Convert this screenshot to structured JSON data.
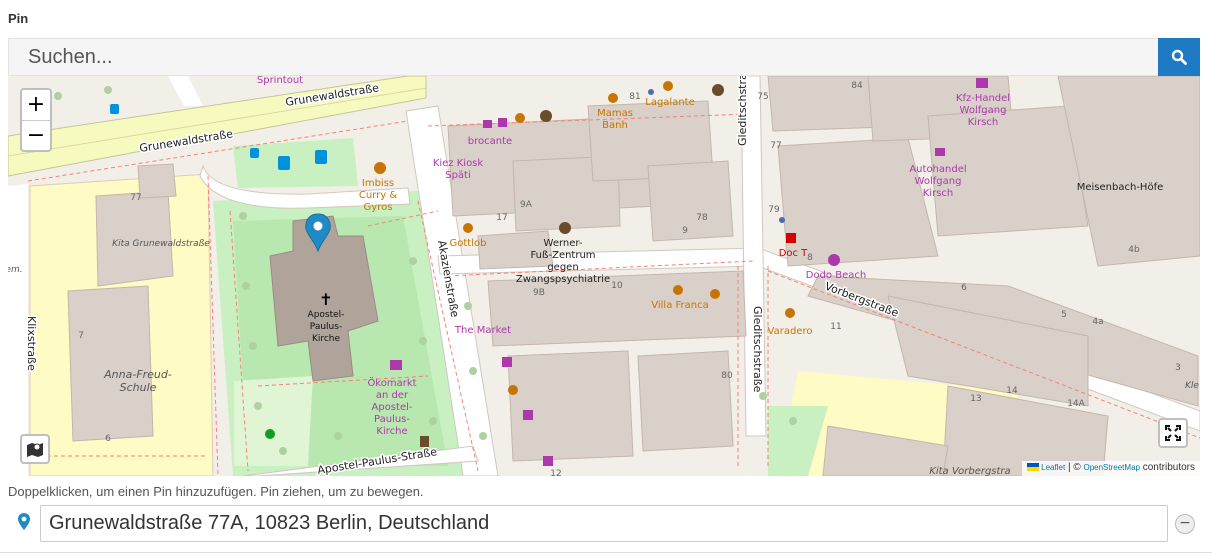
{
  "field": {
    "label": "Pin"
  },
  "search": {
    "placeholder": "Suchen..."
  },
  "map": {
    "zoom_in": "+",
    "zoom_out": "−",
    "attribution": {
      "leaflet": "Leaflet",
      "sep": "| ©",
      "osm": "OpenStreetMap",
      "contributors": "contributors"
    },
    "streets": {
      "grunewald_top": "Grunewaldstraße",
      "grunewald_left": "Grunewaldstraße",
      "akazien": "Akazienstraße",
      "vorberg": "Vorbergstraße",
      "gleditsch_top": "Gleditschstraße",
      "gleditsch_bottom": "Gleditschstraße",
      "klixstrasse": "Klixstraße",
      "apostel_paulus": "Apostel-Paulus-Straße"
    },
    "places": {
      "sprintout": "Sprintout",
      "imbiss_1": "Imbiss",
      "imbiss_2": "Curry &",
      "imbiss_3": "Gyros",
      "kita_grunewald": "Kita Grunewaldstraße",
      "anna_1": "Anna-Freud-",
      "anna_2": "Schule",
      "church_1": "Apostel-",
      "church_2": "Paulus-",
      "church_3": "Kirche",
      "oeko_1": "Ökomarkt",
      "oeko_2": "an der",
      "oeko_3": "Apostel-",
      "oeko_4": "Paulus-",
      "oeko_5": "Kirche",
      "brocante": "brocante",
      "kiez_1": "Kiez Kiosk",
      "kiez_2": "Späti",
      "mamas_1": "Mamas",
      "mamas_2": "Banh",
      "lagalante": "Lagalante",
      "gottlob": "Gottlob",
      "werner_1": "Werner-",
      "werner_2": "Fuß-Zentrum",
      "werner_3": "gegen",
      "werner_4": "Zwangspsychiatrie",
      "market": "The Market",
      "villa": "Villa Franca",
      "varadero": "Varadero",
      "doc": "Doc T",
      "dodo": "Dodo Beach",
      "kfz_1": "Kfz-Handel",
      "kfz_2": "Wolfgang",
      "kfz_3": "Kirsch",
      "auto_1": "Autohandel",
      "auto_2": "Wolfgang",
      "auto_3": "Kirsch",
      "meisenbach": "Meisenbach-Höfe",
      "kita_vorberg": "Kita Vorbergstra",
      "em": "em.",
      "kle": "Kle"
    },
    "numbers": {
      "n77": "77",
      "n7": "7",
      "n6": "6",
      "n9a": "9A",
      "n17": "17",
      "n9": "9",
      "n78": "78",
      "n81": "81",
      "n75": "75",
      "n84": "84",
      "n77b": "77",
      "n79": "79",
      "n8": "8",
      "n4b": "4b",
      "n6b": "6",
      "n5": "5",
      "n4a": "4a",
      "n3": "3",
      "n10": "10",
      "n9b": "9B",
      "n80": "80",
      "n11": "11",
      "n12": "12",
      "n13": "13",
      "n14": "14",
      "n14a": "14A"
    }
  },
  "hint": "Doppelklicken, um einen Pin hinzuzufügen. Pin ziehen, um zu bewegen.",
  "address": {
    "value": "Grunewaldstraße 77A, 10823 Berlin, Deutschland",
    "remove_label": "−"
  },
  "colors": {
    "accent": "#1e7ac2",
    "pin": "#1f8bc4",
    "poi_purple": "#ac39ac",
    "poi_orange": "#c77400"
  }
}
